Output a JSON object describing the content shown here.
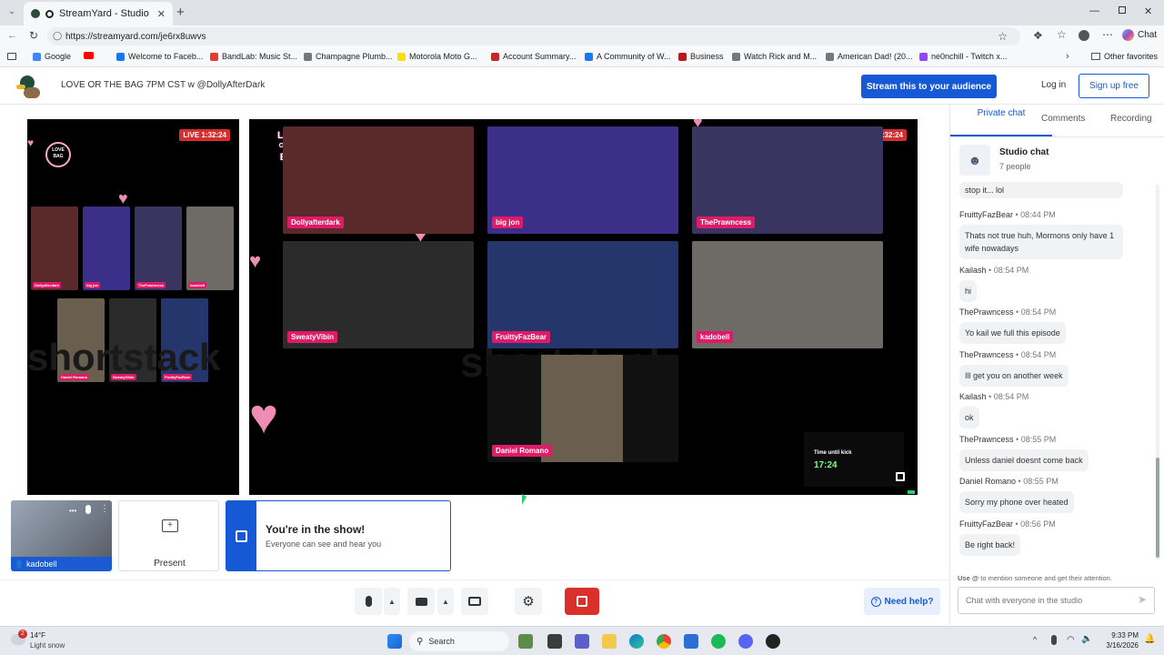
{
  "browser": {
    "tab_title": "StreamYard - Studio",
    "url": "https://streamyard.com/je6rx8uwvs",
    "new_tab": "+",
    "chat_label": "Chat",
    "bookmarks": [
      {
        "label": "Google",
        "color": "#4285f4"
      },
      {
        "label": "",
        "color": "#ff0000"
      },
      {
        "label": "Welcome to Faceb...",
        "color": "#1877f2"
      },
      {
        "label": "BandLab: Music St...",
        "color": "#e53935"
      },
      {
        "label": "Champagne Plumb...",
        "color": "#777777"
      },
      {
        "label": "Motorola Moto G...",
        "color": "#f9e000"
      },
      {
        "label": "Account Summary...",
        "color": "#c62828"
      },
      {
        "label": "A Community of W...",
        "color": "#1877f2"
      },
      {
        "label": "Business",
        "color": "#b71c1c"
      },
      {
        "label": "Watch Rick and M...",
        "color": "#777777"
      },
      {
        "label": "American Dad! (20...",
        "color": "#777777"
      },
      {
        "label": "ne0nchill - Twitch x...",
        "color": "#9146ff"
      }
    ],
    "other_favorites": "Other favorites"
  },
  "header": {
    "title": "LOVE OR THE BAG 7PM CST w @DollyAfterDark",
    "stream_button": "Stream this to your audience",
    "login": "Log in",
    "signup": "Sign up free"
  },
  "stage": {
    "live_badge": "LIVE 1:32:24",
    "logo_line1": "LOVE",
    "logo_line2": "OR THE",
    "logo_line3": "BAG",
    "watermark": "shortstack",
    "participants": [
      {
        "name": "Dollyafterdark",
        "bg": "#5a2a2a"
      },
      {
        "name": "big jon",
        "bg": "#3b2f8a"
      },
      {
        "name": "ThePrawncess",
        "bg": "#3a3560"
      },
      {
        "name": "SweatyVibin",
        "bg": "#2b2b2b"
      },
      {
        "name": "FruittyFazBear",
        "bg": "#24366b"
      },
      {
        "name": "kadobell",
        "bg": "#6e6a66"
      },
      {
        "name": "Daniel Romano",
        "bg": "#6a5e4e"
      }
    ],
    "small_names": [
      "Dollyafterdark",
      "big jon",
      "ThePrawncess",
      "kadobell",
      "Daniel Romano",
      "SweatyVibin",
      "FruittyFazBear"
    ],
    "timer_label": "Time until kick",
    "timer_value": "17:24"
  },
  "self_tile": {
    "name": "kadobell"
  },
  "present": {
    "label": "Present"
  },
  "in_show": {
    "title": "You're in the show!",
    "subtitle": "Everyone can see and hear you"
  },
  "help": {
    "label": "Need help?"
  },
  "sidebar": {
    "tabs": [
      {
        "label": "Private chat",
        "active": true
      },
      {
        "label": "Comments",
        "active": false
      },
      {
        "label": "Recording",
        "active": false
      }
    ],
    "studio_chat": {
      "title": "Studio chat",
      "people": "7 people"
    },
    "top_partial": "stop it... lol",
    "messages": [
      {
        "author": "FruittyFazBear",
        "time": "08:44 PM",
        "text": "Thats not true huh, Mormons only have 1 wife nowadays"
      },
      {
        "author": "Kailash",
        "time": "08:54 PM",
        "text": "hi"
      },
      {
        "author": "ThePrawncess",
        "time": "08:54 PM",
        "text": "Yo kail we full this episode"
      },
      {
        "author": "ThePrawncess",
        "time": "08:54 PM",
        "text": "Ill get you on another week"
      },
      {
        "author": "Kailash",
        "time": "08:54 PM",
        "text": "ok"
      },
      {
        "author": "ThePrawncess",
        "time": "08:55 PM",
        "text": "Unless daniel doesnt come back"
      },
      {
        "author": "Daniel Romano",
        "time": "08:55 PM",
        "text": "Sorry my phone over heated"
      },
      {
        "author": "FruittyFazBear",
        "time": "08:56 PM",
        "text": "Be right back!"
      }
    ],
    "mention_hint_prefix": "Use @",
    "mention_hint_suffix": " to mention someone and get their attention.",
    "chat_placeholder": "Chat with everyone in the studio"
  },
  "taskbar": {
    "weather_temp": "14°F",
    "weather_desc": "Light snow",
    "weather_badge": "2",
    "search": "Search",
    "time": "9:33 PM",
    "date": "3/16/2026"
  }
}
